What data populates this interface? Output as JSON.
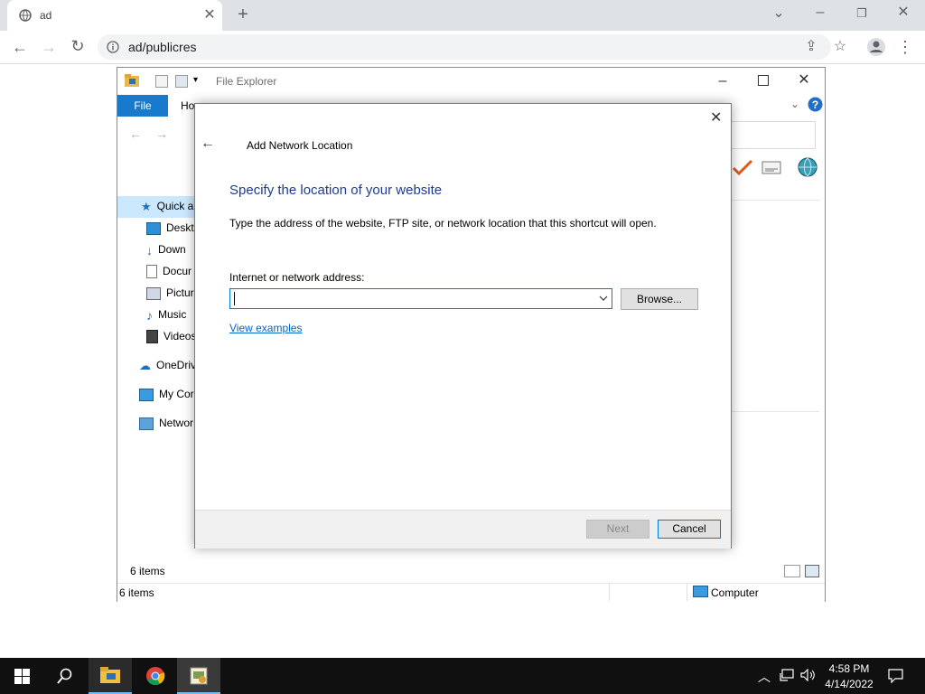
{
  "browser": {
    "tab_title": "ad",
    "address": "ad/publicres"
  },
  "explorer": {
    "title": "File Explorer",
    "file_tab": "File",
    "home_tab": "Ho",
    "nav_items": [
      {
        "label": "Quick a",
        "icon": "star-icon"
      },
      {
        "label": "Deskto",
        "icon": "desktop-icon"
      },
      {
        "label": "Down",
        "icon": "download-icon"
      },
      {
        "label": "Docur",
        "icon": "document-icon"
      },
      {
        "label": "Pictur",
        "icon": "pictures-icon"
      },
      {
        "label": "Music",
        "icon": "music-icon"
      },
      {
        "label": "Videos",
        "icon": "videos-icon"
      },
      {
        "label": "OneDriv",
        "icon": "cloud-icon"
      },
      {
        "label": "My Cor",
        "icon": "computer-icon"
      },
      {
        "label": "Networ",
        "icon": "network-icon"
      }
    ],
    "item_count": "6 items",
    "status_count": "6 items",
    "status_location": "Computer"
  },
  "dialog": {
    "title": "Add Network Location",
    "heading": "Specify the location of your website",
    "description": "Type the address of the website, FTP site, or network location that this shortcut will open.",
    "address_label": "Internet or network address:",
    "address_value": "",
    "browse_label": "Browse...",
    "examples_link": "View examples",
    "next_label": "Next",
    "cancel_label": "Cancel"
  },
  "taskbar": {
    "time": "4:58 PM",
    "date": "4/14/2022"
  },
  "colors": {
    "accent": "#1979ca",
    "heading": "#1e3d8f",
    "link": "#0066cc"
  }
}
